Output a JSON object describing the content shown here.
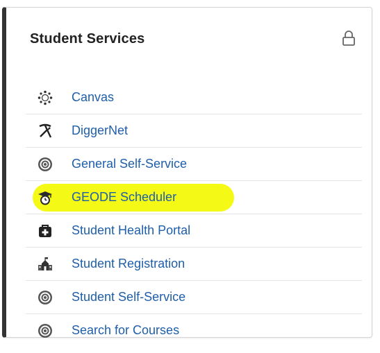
{
  "panel": {
    "title": "Student Services",
    "lock_icon": "lock-icon",
    "items": [
      {
        "label": "Canvas",
        "icon": "canvas-icon",
        "highlighted": false
      },
      {
        "label": "DiggerNet",
        "icon": "pickaxe-shovel-icon",
        "highlighted": false
      },
      {
        "label": "General Self-Service",
        "icon": "target-icon",
        "highlighted": false
      },
      {
        "label": "GEODE Scheduler",
        "icon": "graduation-cap-clock-icon",
        "highlighted": true
      },
      {
        "label": "Student Health Portal",
        "icon": "medical-bag-icon",
        "highlighted": false
      },
      {
        "label": "Student Registration",
        "icon": "school-building-icon",
        "highlighted": false
      },
      {
        "label": "Student Self-Service",
        "icon": "target-icon",
        "highlighted": false
      },
      {
        "label": "Search for Courses",
        "icon": "target-icon",
        "highlighted": false
      }
    ]
  },
  "colors": {
    "link": "#1f5ea8",
    "highlight": "#f4f90a",
    "title": "#222222"
  }
}
